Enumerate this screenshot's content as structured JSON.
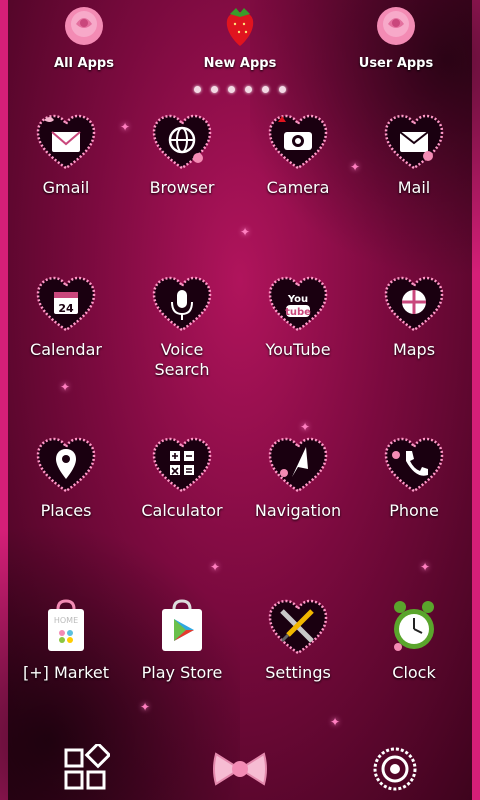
{
  "theme_colors": {
    "accent": "#d51f78",
    "background_deep": "#3c031c",
    "heart_fill": "#1a0010",
    "heart_outline": "#ff9ac8"
  },
  "top_bar": [
    {
      "label": "All Apps",
      "icon": "rose-icon"
    },
    {
      "label": "New Apps",
      "icon": "strawberry-icon"
    },
    {
      "label": "User Apps",
      "icon": "rose-icon"
    }
  ],
  "page_indicator": {
    "count": 6
  },
  "apps": [
    {
      "label": "Gmail",
      "icon": "gmail-envelope-icon"
    },
    {
      "label": "Browser",
      "icon": "globe-icon"
    },
    {
      "label": "Camera",
      "icon": "camera-icon"
    },
    {
      "label": "Mail",
      "icon": "envelope-icon"
    },
    {
      "label": "Calendar",
      "icon": "calendar-icon",
      "calendar_day": "24"
    },
    {
      "label": "Voice\nSearch",
      "icon": "microphone-icon"
    },
    {
      "label": "YouTube",
      "icon": "youtube-icon",
      "youtube_top": "You",
      "youtube_bottom": "tube"
    },
    {
      "label": "Maps",
      "icon": "map-icon"
    },
    {
      "label": "Places",
      "icon": "map-pin-icon"
    },
    {
      "label": "Calculator",
      "icon": "calculator-icon"
    },
    {
      "label": "Navigation",
      "icon": "navigation-arrow-icon"
    },
    {
      "label": "Phone",
      "icon": "phone-handset-icon"
    },
    {
      "label": "[+] Market",
      "icon": "shopping-bag-icon",
      "bag_text": "HOME"
    },
    {
      "label": "Play Store",
      "icon": "play-store-bag-icon"
    },
    {
      "label": "Settings",
      "icon": "wrench-screwdriver-icon"
    },
    {
      "label": "Clock",
      "icon": "alarm-clock-icon"
    }
  ],
  "dock": [
    {
      "name": "widgets-button",
      "icon": "widgets-grid-icon"
    },
    {
      "name": "home-button",
      "icon": "bow-icon"
    },
    {
      "name": "settings-button",
      "icon": "gear-circle-icon"
    }
  ]
}
